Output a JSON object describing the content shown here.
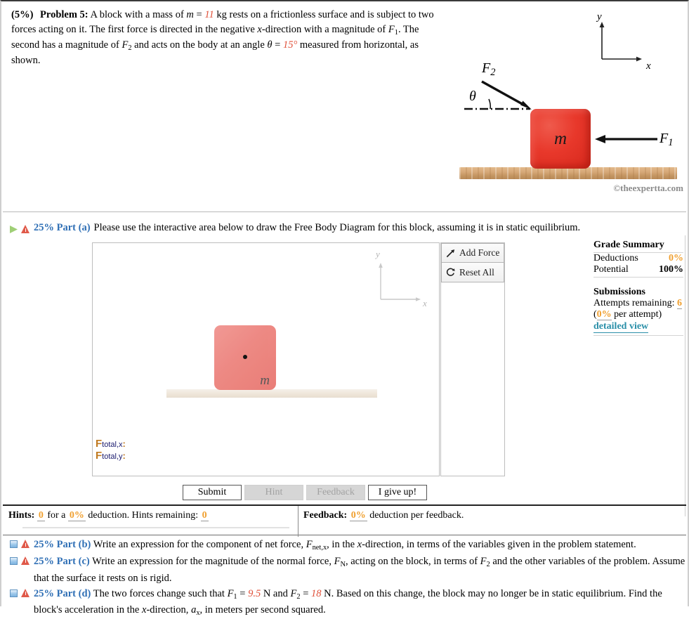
{
  "problem": {
    "weight": "(5%)",
    "title": "Problem 5:",
    "text_1": "A block with a mass of ",
    "m_sym": "m",
    "eq1": " = ",
    "m_val": "11",
    "text_2": " kg rests on a frictionless surface and is subject to two forces acting on it. The first force is directed in the negative ",
    "x_sym": "x",
    "text_3": "-direction with a magnitude of ",
    "F1_sym": "F",
    "F1_sub": "1",
    "text_4": ". The second has a magnitude of ",
    "F2_sym": "F",
    "F2_sub": "2",
    "text_5": " and acts on the body at an angle ",
    "theta_sym": "θ",
    "eq2": " = ",
    "theta_val": "15°",
    "text_6": " measured from horizontal, as shown."
  },
  "figure": {
    "axis_y": "y",
    "axis_x": "x",
    "block_label": "m",
    "force2_label": "F",
    "force2_sub": "2",
    "force1_label": "F",
    "force1_sub": "1",
    "theta_label": "θ",
    "copyright": "©theexpertta.com"
  },
  "part_a": {
    "percent": "25% Part (a)",
    "prompt": "Please use the interactive area below to draw the Free Body Diagram for this block, assuming it is in static equilibrium.",
    "play_icon": "play-triangle-icon",
    "warning_icon": "warning-triangle-icon"
  },
  "canvas": {
    "axis_y": "y",
    "axis_x": "x",
    "block_label": "m",
    "ftotal_x_F": "F",
    "ftotal_x_sub": "total,x",
    "ftotal_x_colon": ":",
    "ftotal_y_F": "F",
    "ftotal_y_sub": "total,y",
    "ftotal_y_colon": ":"
  },
  "tools": {
    "add_force": "Add Force",
    "reset_all": "Reset All",
    "add_force_icon": "arrow-up-right-icon",
    "reset_icon": "circular-reset-arrow-icon"
  },
  "actions": {
    "submit": "Submit",
    "hint": "Hint",
    "feedback": "Feedback",
    "give_up": "I give up!"
  },
  "grade_summary": {
    "title": "Grade Summary",
    "rows": [
      {
        "label": "Deductions",
        "value": "0%"
      },
      {
        "label": "Potential",
        "value": "100%"
      }
    ],
    "submissions_title": "Submissions",
    "attempts_label": "Attempts remaining:",
    "attempts_value": "6",
    "per_attempt": "(0% per attempt)",
    "per_attempt_pct": "0%",
    "per_attempt_pre": "(",
    "per_attempt_post": " per attempt)",
    "detailed_view": "detailed view"
  },
  "hints_bar": {
    "hints_label": "Hints:",
    "hints_count": "0",
    "hints_mid": "for a",
    "hints_deduction": "0%",
    "hints_after": "deduction. Hints remaining:",
    "hints_remaining": "0",
    "feedback_label": "Feedback:",
    "feedback_pct": "0%",
    "feedback_after": "deduction per feedback."
  },
  "part_b": {
    "percent": "25% Part (b)",
    "pre": "Write an expression for the component of net force, ",
    "F_sym": "F",
    "F_sub": "net,x",
    "mid": ", in the ",
    "x_sym": "x",
    "post": "-direction, in terms of the variables given in the problem statement."
  },
  "part_c": {
    "percent": "25% Part (c)",
    "pre": "Write an expression for the magnitude of the normal force, ",
    "F_sym": "F",
    "F_sub": "N",
    "mid": ", acting on the block, in terms of ",
    "F2_sym": "F",
    "F2_sub": "2",
    "post": " and the other variables of the problem. Assume that the surface it rests on is rigid."
  },
  "part_d": {
    "percent": "25% Part (d)",
    "pre": "The two forces change such that ",
    "F1_sym": "F",
    "F1_sub": "1",
    "eq1": " = ",
    "F1_val": "9.5",
    "mid1": " N and ",
    "F2_sym": "F",
    "F2_sub": "2",
    "eq2": " = ",
    "F2_val": "18",
    "mid2": " N. Based on this change, the block may no longer be in static equilibrium. Find the block's acceleration in the ",
    "x_sym": "x",
    "mid3": "-direction, ",
    "a_sym": "a",
    "a_sub": "x",
    "post": ", in meters per second squared."
  },
  "colors": {
    "value_red": "#e0513a",
    "part_blue": "#2f6fb5",
    "orange": "#f0a030",
    "link_teal": "#2a8fa8"
  }
}
